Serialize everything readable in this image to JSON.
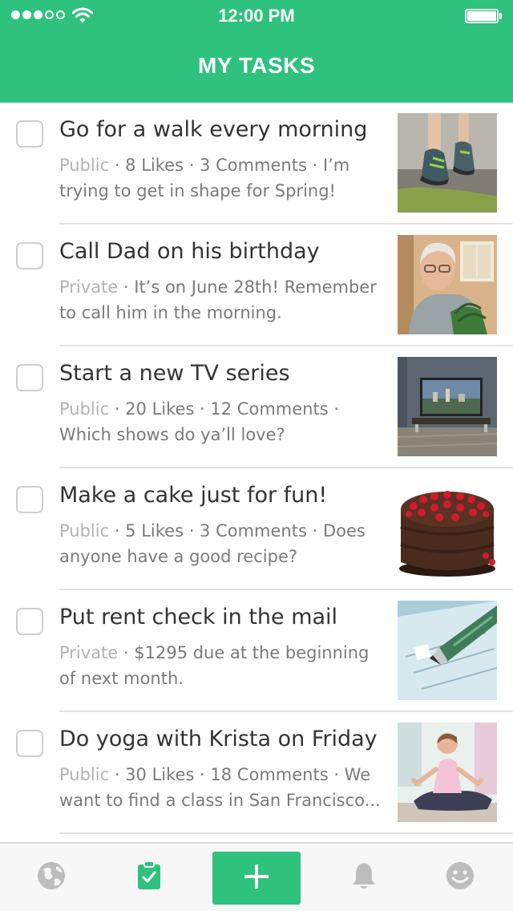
{
  "status_bar": {
    "time": "12:00 PM",
    "signal_bars": 3,
    "signal_total": 5,
    "icons": [
      "signal-dots",
      "wifi-icon",
      "battery-icon"
    ]
  },
  "header": {
    "title": "MY TASKS",
    "background_color": "#2ec27e"
  },
  "tasks": [
    {
      "title": "Go for a walk every morning",
      "privacy": "Public",
      "details": " · 8 Likes · 3 Comments · I’m trying to get in shape for Spring!",
      "completed": false,
      "thumbnail": "walking-shoes"
    },
    {
      "title": "Call Dad on his birthday",
      "privacy": "Private",
      "details": " · It’s on June 28th! Remember to call him in the morning.",
      "completed": false,
      "thumbnail": "older-man"
    },
    {
      "title": "Start a new TV series",
      "privacy": "Public",
      "details": " · 20 Likes · 12 Comments · Which shows do ya’ll love?",
      "completed": false,
      "thumbnail": "television"
    },
    {
      "title": "Make a cake just for fun!",
      "privacy": "Public",
      "details": " · 5 Likes · 3 Comments · Does anyone have a good recipe?",
      "completed": false,
      "thumbnail": "chocolate-cake"
    },
    {
      "title": "Put rent check in the mail",
      "privacy": "Private",
      "details": " · $1295 due at the beginning of next month.",
      "completed": false,
      "thumbnail": "check-and-pen"
    },
    {
      "title": "Do yoga with Krista on Friday",
      "privacy": "Public",
      "details": " · 30 Likes · 18 Comments · We want to find a class in San Francisco...",
      "completed": false,
      "thumbnail": "yoga"
    }
  ],
  "tab_bar": {
    "items": [
      {
        "icon": "globe-icon",
        "active": false
      },
      {
        "icon": "clipboard-check-icon",
        "active": true
      },
      {
        "icon": "plus-icon",
        "active": false
      },
      {
        "icon": "bell-icon",
        "active": false
      },
      {
        "icon": "smiley-icon",
        "active": false
      }
    ],
    "accent_color": "#2ec27e",
    "inactive_color": "#bdbdbd"
  }
}
